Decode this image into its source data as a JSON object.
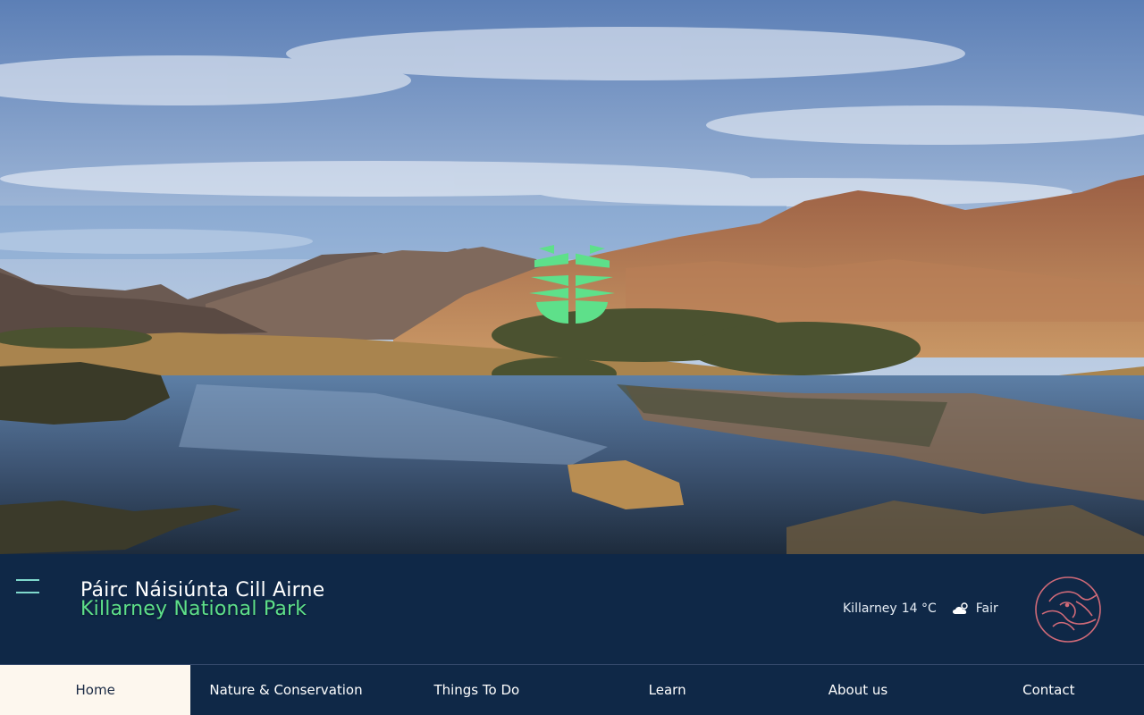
{
  "site": {
    "title_irish": "Páirc Náisiúnta Cill Airne",
    "title_english": "Killarney National Park"
  },
  "weather": {
    "location": "Killarney",
    "temperature": "14 °C",
    "condition": "Fair",
    "icon": "cloud-sun-icon"
  },
  "nav": {
    "items": [
      {
        "label": "Home",
        "active": true
      },
      {
        "label": "Nature & Conservation",
        "active": false
      },
      {
        "label": "Things To Do",
        "active": false
      },
      {
        "label": "Learn",
        "active": false
      },
      {
        "label": "About us",
        "active": false
      },
      {
        "label": "Contact",
        "active": false
      }
    ]
  },
  "icons": {
    "menu": "hamburger-menu-icon",
    "park_logo": "fern-leaf-logo",
    "emblem": "bird-emblem-logo"
  },
  "colors": {
    "header_bg": "#0f2847",
    "accent_green": "#5ee08a",
    "active_tab_bg": "#fdf7ee",
    "emblem_pink": "#d06a78"
  }
}
